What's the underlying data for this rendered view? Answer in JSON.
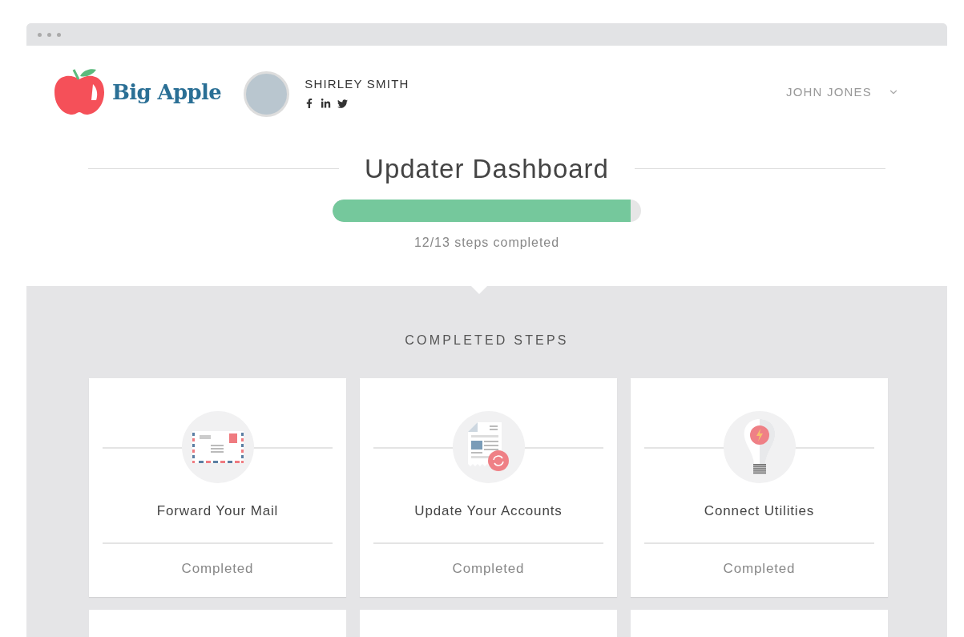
{
  "brand": {
    "name": "Big Apple"
  },
  "agent": {
    "name": "SHIRLEY SMITH"
  },
  "user_menu": {
    "label": "JOHN JONES"
  },
  "title": "Updater Dashboard",
  "progress": {
    "level": 0.965,
    "caption": "12/13 steps completed"
  },
  "section_title": "COMPLETED STEPS",
  "steps": [
    {
      "kind": "mail",
      "title": "Forward Your Mail",
      "status": "Completed"
    },
    {
      "kind": "accounts",
      "title": "Update Your Accounts",
      "status": "Completed"
    },
    {
      "kind": "utilities",
      "title": "Connect Utilities",
      "status": "Completed"
    }
  ]
}
